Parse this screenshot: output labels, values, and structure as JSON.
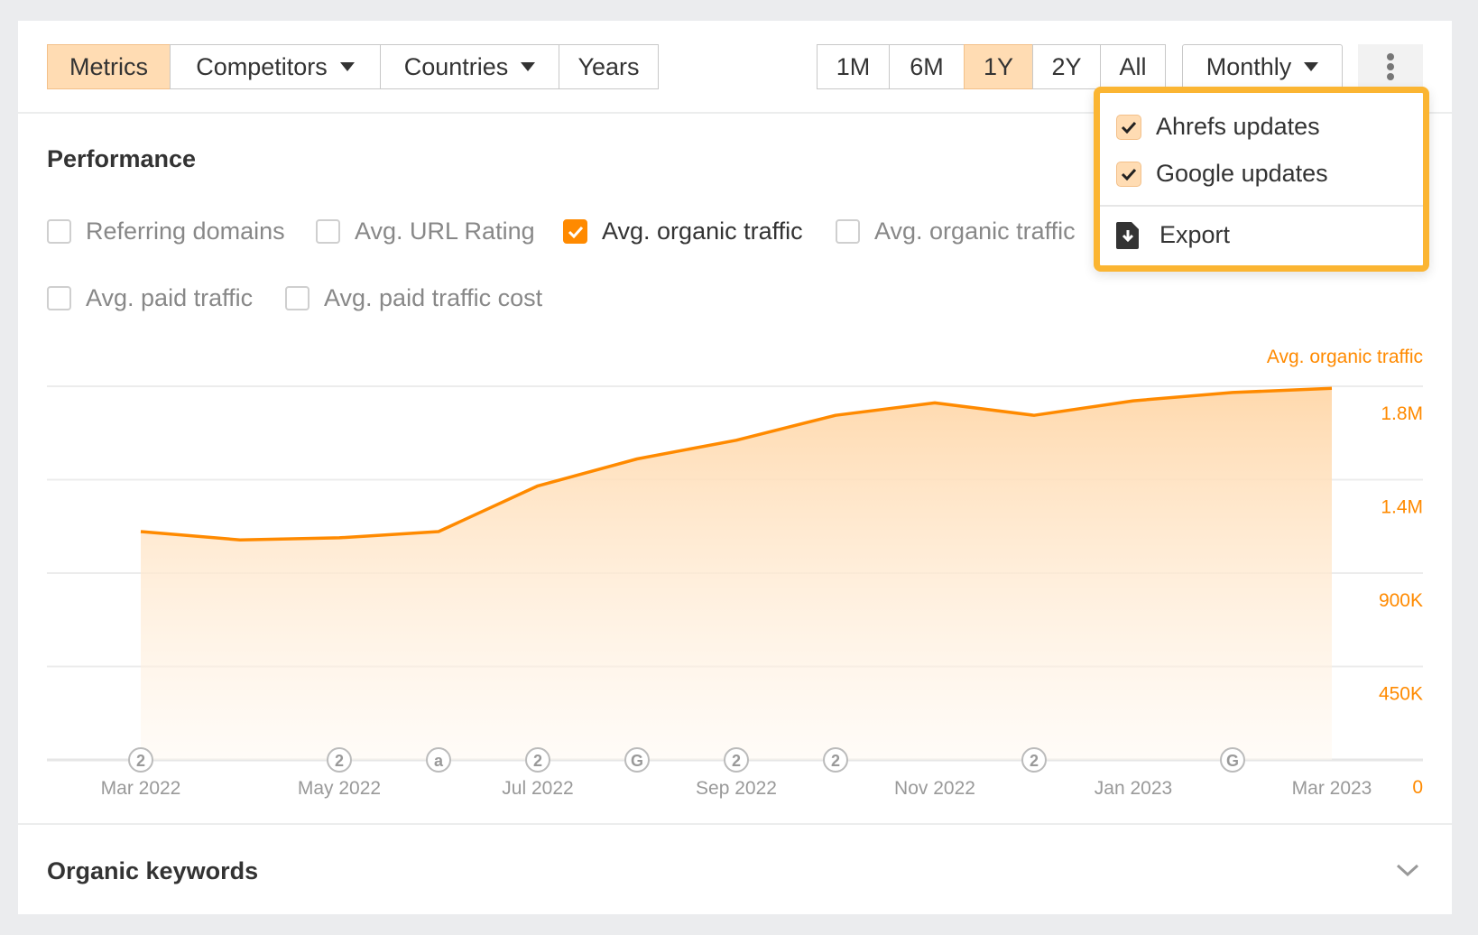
{
  "toolbar": {
    "tabs": [
      {
        "label": "Metrics",
        "selected": true
      },
      {
        "label": "Competitors",
        "dropdown": true
      },
      {
        "label": "Countries",
        "dropdown": true
      },
      {
        "label": "Years"
      }
    ],
    "ranges": [
      {
        "label": "1M"
      },
      {
        "label": "6M"
      },
      {
        "label": "1Y",
        "selected": true
      },
      {
        "label": "2Y"
      },
      {
        "label": "All"
      }
    ],
    "interval": "Monthly",
    "more_icon": "kebab-vertical-icon"
  },
  "menu": {
    "items": [
      {
        "label": "Ahrefs updates",
        "checked": true
      },
      {
        "label": "Google updates",
        "checked": true
      }
    ],
    "export_label": "Export",
    "export_icon": "file-download-icon"
  },
  "performance": {
    "title": "Performance",
    "metrics": [
      {
        "label": "Referring domains",
        "checked": false
      },
      {
        "label": "Avg. URL Rating",
        "checked": false
      },
      {
        "label": "Avg. organic traffic",
        "checked": true
      },
      {
        "label": "Avg. organic traffic",
        "checked": false
      },
      {
        "label": "Avg. paid traffic",
        "checked": false
      },
      {
        "label": "Avg. paid traffic cost",
        "checked": false
      }
    ]
  },
  "chart_data": {
    "type": "area",
    "series": [
      {
        "name": "Avg. organic traffic",
        "color": "#ff8a00",
        "x": [
          "Mar 2022",
          "Apr 2022",
          "May 2022",
          "Jun 2022",
          "Jul 2022",
          "Aug 2022",
          "Sep 2022",
          "Oct 2022",
          "Nov 2022",
          "Dec 2022",
          "Jan 2023",
          "Feb 2023",
          "Mar 2023"
        ],
        "values": [
          1100000,
          1060000,
          1070000,
          1100000,
          1320000,
          1450000,
          1540000,
          1660000,
          1720000,
          1660000,
          1730000,
          1770000,
          1790000
        ]
      }
    ],
    "x_tick_labels": [
      "Mar 2022",
      "May 2022",
      "Jul 2022",
      "Sep 2022",
      "Nov 2022",
      "Jan 2023",
      "Mar 2023"
    ],
    "y_tick_labels": [
      "0",
      "450K",
      "900K",
      "1.4M",
      "1.8M"
    ],
    "y_ticks": [
      0,
      450000,
      900000,
      1350000,
      1800000
    ],
    "ylim": [
      0,
      1800000
    ],
    "axis_position": "right",
    "grid": true,
    "annotations": [
      {
        "x": "Mar 2022",
        "label": "2"
      },
      {
        "x": "May 2022",
        "label": "2"
      },
      {
        "x": "Jun 2022",
        "label": "a"
      },
      {
        "x": "Jul 2022",
        "label": "2"
      },
      {
        "x": "Aug 2022",
        "label": "G"
      },
      {
        "x": "Sep 2022",
        "label": "2"
      },
      {
        "x": "Oct 2022",
        "label": "2"
      },
      {
        "x": "Dec 2022",
        "label": "2"
      },
      {
        "x": "Feb 2023",
        "label": "G"
      }
    ]
  },
  "organic_keywords": {
    "title": "Organic keywords",
    "expand_icon": "chevron-down-icon"
  }
}
